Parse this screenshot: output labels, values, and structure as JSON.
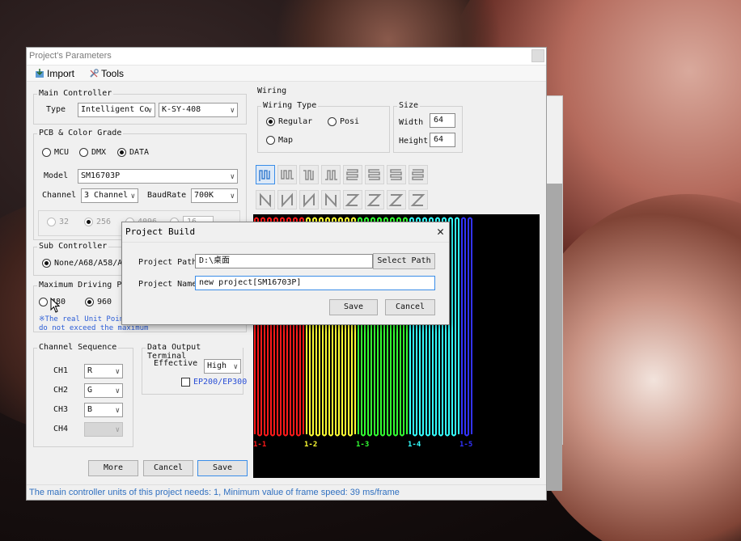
{
  "window": {
    "title": "Project's Parameters",
    "toolbar": {
      "import_label": "Import",
      "tools_label": "Tools"
    }
  },
  "main_controller": {
    "legend": "Main Controller",
    "type_label": "Type",
    "type_value": "Intelligent Co",
    "model_value": "K-SY-408"
  },
  "pcb": {
    "legend": "PCB & Color Grade",
    "radios": [
      "MCU",
      "DMX",
      "DATA"
    ],
    "selected": "DATA",
    "model_label": "Model",
    "model_value": "SM16703P",
    "channel_label": "Channel",
    "channel_value": "3 Channel",
    "baud_label": "BaudRate",
    "baud_value": "700K",
    "grade_options": [
      "32",
      "256",
      "4096",
      "16"
    ]
  },
  "sub_controller": {
    "legend": "Sub Controller",
    "option": "None/A68/A58/A88"
  },
  "max_points": {
    "legend": "Maximum Driving Point",
    "options": [
      "480",
      "960"
    ],
    "note_line1": "※The real Unit Poin",
    "note_line2": "do not exceed the maximum"
  },
  "channel_sequence": {
    "legend": "Channel Sequence",
    "rows": [
      {
        "label": "CH1",
        "value": "R"
      },
      {
        "label": "CH2",
        "value": "G"
      },
      {
        "label": "CH3",
        "value": "B"
      },
      {
        "label": "CH4",
        "value": ""
      }
    ]
  },
  "data_output": {
    "legend": "Data Output Terminal",
    "effective_label": "Effective",
    "effective_value": "High",
    "ep_label": "EP200/EP300"
  },
  "wiring": {
    "legend": "Wiring",
    "type_legend": "Wiring Type",
    "types": [
      "Regular",
      "Posi",
      "Map"
    ],
    "size_legend": "Size",
    "width_label": "Width",
    "width_value": "64",
    "height_label": "Height",
    "height_value": "64"
  },
  "preview": {
    "labels": [
      "1-1",
      "1-2",
      "1-3",
      "1-4",
      "1-5"
    ],
    "colors": [
      "#ff1a1a",
      "#ffff33",
      "#33ff33",
      "#33ffff",
      "#3333ff"
    ]
  },
  "buttons": {
    "more": "More",
    "cancel": "Cancel",
    "save": "Save"
  },
  "status_text": "The main controller units of this project needs: 1,   Minimum value of frame speed: 39 ms/frame",
  "dialog": {
    "title": "Project Build",
    "close": "✕",
    "path_label": "Project Path",
    "path_value": "D:\\桌面",
    "select_path": "Select Path",
    "name_label": "Project Name",
    "name_value": "new project[SM16703P]",
    "save": "Save",
    "cancel": "Cancel"
  }
}
